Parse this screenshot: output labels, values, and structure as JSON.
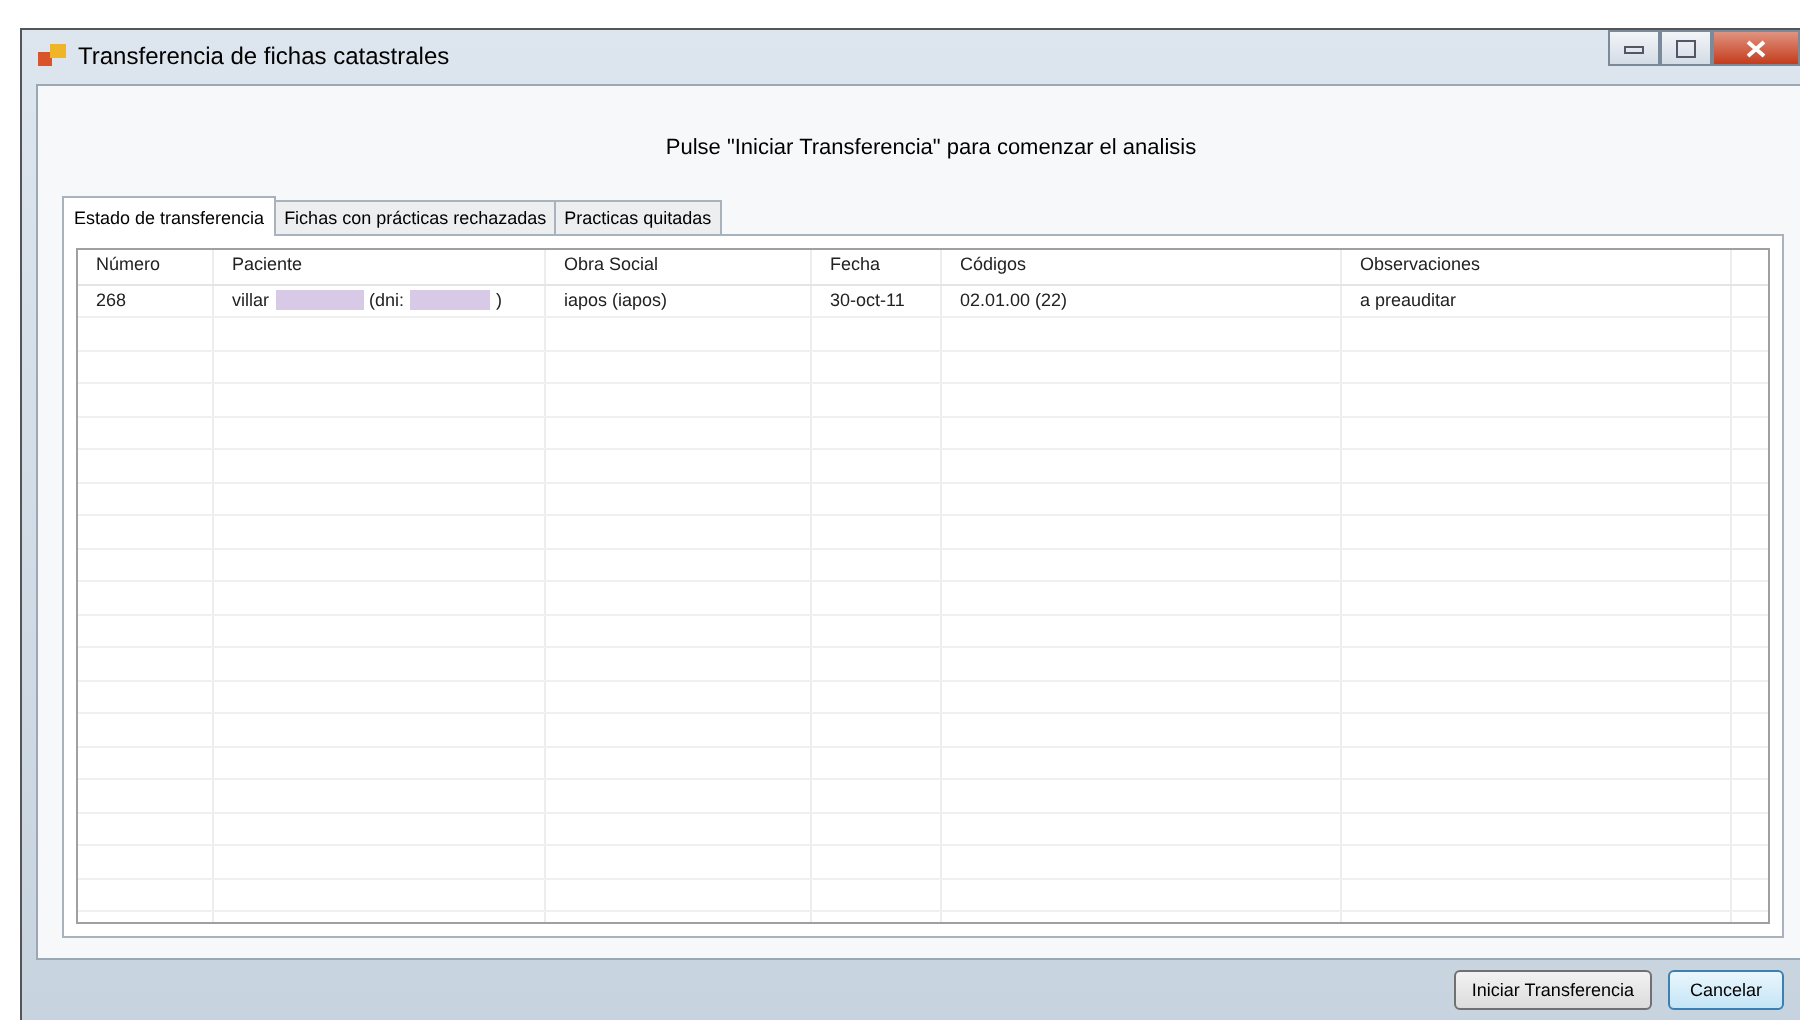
{
  "window": {
    "title": "Transferencia de fichas catastrales"
  },
  "instruction": "Pulse \"Iniciar Transferencia\" para comenzar el analisis",
  "tabs": [
    {
      "label": "Estado de transferencia",
      "selected": true
    },
    {
      "label": "Fichas con prácticas rechazadas",
      "selected": false
    },
    {
      "label": "Practicas quitadas",
      "selected": false
    }
  ],
  "table": {
    "columns": [
      "Número",
      "Paciente",
      "Obra Social",
      "Fecha",
      "Códigos",
      "Observaciones"
    ],
    "rows": [
      {
        "numero": "268",
        "paciente": [
          "villar",
          "(dni:",
          ")"
        ],
        "obra_social": "iapos (iapos)",
        "fecha": "30-oct-11",
        "codigos": "02.01.00 (22)",
        "observaciones": "a preauditar"
      }
    ]
  },
  "buttons": [
    {
      "label": "Iniciar Transferencia",
      "kind": "normal"
    },
    {
      "label": "Cancelar",
      "kind": "default"
    }
  ]
}
